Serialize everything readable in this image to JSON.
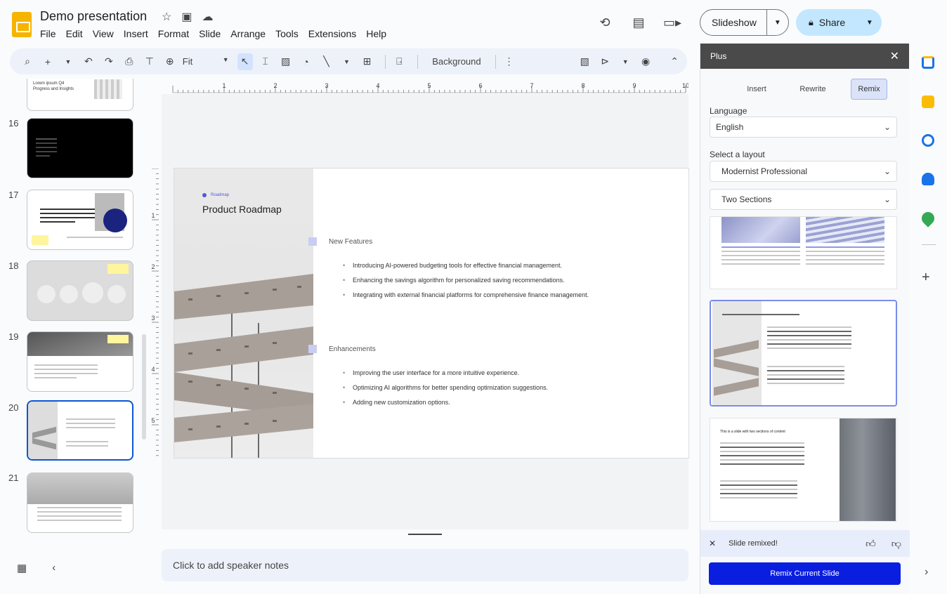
{
  "header": {
    "title": "Demo presentation",
    "menu": [
      "File",
      "Edit",
      "View",
      "Insert",
      "Format",
      "Slide",
      "Arrange",
      "Tools",
      "Extensions",
      "Help"
    ],
    "slideshow_label": "Slideshow",
    "share_label": "Share"
  },
  "toolbar": {
    "zoom_value": "Fit",
    "background_label": "Background"
  },
  "filmstrip": {
    "slide_numbers": [
      "16",
      "17",
      "18",
      "19",
      "20",
      "21"
    ],
    "partial_thumb_text": "Lorem ipsum Q4 Progress and Insights",
    "selected": "20"
  },
  "slide": {
    "kicker": "Roadmap",
    "title": "Product Roadmap",
    "section1": "New Features",
    "section1_bullets": [
      "Introducing AI-powered budgeting tools for effective financial management.",
      "Enhancing the savings algorithm for personalized saving recommendations.",
      "Integrating with external financial platforms for comprehensive finance management."
    ],
    "section2": "Enhancements",
    "section2_bullets": [
      "Improving the user interface for a more intuitive experience.",
      "Optimizing AI algorithms for better spending optimization suggestions.",
      "Adding new customization options."
    ]
  },
  "notes": {
    "placeholder": "Click to add speaker notes"
  },
  "panel": {
    "title": "Plus",
    "modes": [
      "Insert",
      "Rewrite",
      "Remix"
    ],
    "active_mode": "Remix",
    "language_label": "Language",
    "language_value": "English",
    "layout_label": "Select a layout",
    "layout_value": "Modernist Professional",
    "sections_value": "Two Sections",
    "card3_title": "This is a slide with two sections of content",
    "status_text": "Slide remixed!",
    "remix_button": "Remix Current Slide"
  },
  "colors": {
    "accent": "#0b57d0",
    "share_bg": "#c2e7ff",
    "remix_button": "#0a1ee0",
    "slide_accent": "#4b5bd8"
  }
}
